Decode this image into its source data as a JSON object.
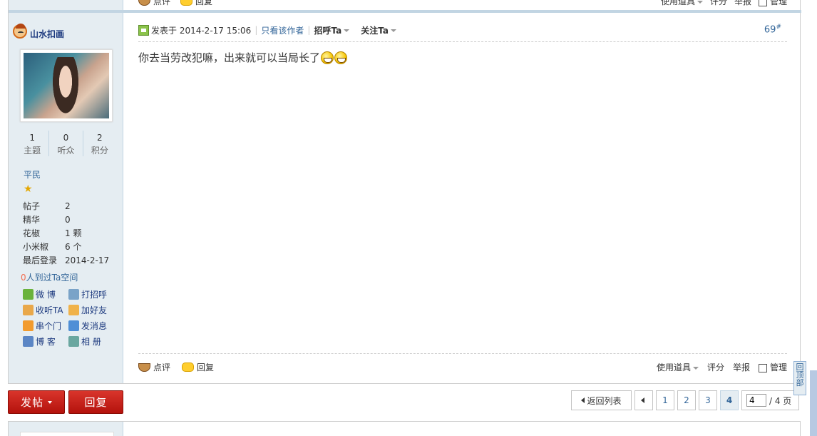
{
  "prev_post_actions": {
    "comment": "点评",
    "reply": "回复",
    "tools": "使用道具",
    "rate": "评分",
    "report": "举报",
    "manage": "管理"
  },
  "user": {
    "name": "山水扣画",
    "stats": [
      {
        "value": "1",
        "label": "主题"
      },
      {
        "value": "0",
        "label": "听众"
      },
      {
        "value": "2",
        "label": "积分"
      }
    ],
    "rank": "平民",
    "info": [
      {
        "key": "帖子",
        "value": "2"
      },
      {
        "key": "精华",
        "value": "0"
      },
      {
        "key": "花椒",
        "value": "1 颗"
      },
      {
        "key": "小米椒",
        "value": "6 个"
      },
      {
        "key": "最后登录",
        "value": "2014-2-17"
      }
    ],
    "visits_count": "0",
    "visits_text": "人到过Ta空间",
    "actions": [
      {
        "label": "微 博",
        "icon": "weibo-icon",
        "color": "#6ab23c"
      },
      {
        "label": "打招呼",
        "icon": "wave-icon",
        "color": "#7aa3c8"
      },
      {
        "label": "收听TA",
        "icon": "follow-users-icon",
        "color": "#e9a84a"
      },
      {
        "label": "加好友",
        "icon": "handshake-icon",
        "color": "#f0b24a"
      },
      {
        "label": "串个门",
        "icon": "home-icon",
        "color": "#f29b2e"
      },
      {
        "label": "发消息",
        "icon": "mail-icon",
        "color": "#4f8fd6"
      },
      {
        "label": "博 客",
        "icon": "blog-icon",
        "color": "#5b86c5"
      },
      {
        "label": "相 册",
        "icon": "album-icon",
        "color": "#6aa7a0"
      }
    ]
  },
  "post": {
    "posted_prefix": "发表于 2014-2-17 15:06",
    "only_author": "只看该作者",
    "greet": "招呼Ta",
    "follow": "关注Ta",
    "floor": "69",
    "floor_mark": "#",
    "content": "你去当劳改犯嘛，出来就可以当局长了",
    "emoticon": "grin-icon"
  },
  "post_actions": {
    "comment": "点评",
    "reply": "回复",
    "tools": "使用道具",
    "rate": "评分",
    "report": "举报",
    "manage": "管理"
  },
  "bottom": {
    "new_post": "发帖",
    "reply": "回复",
    "back_to_list": "返回列表",
    "pages": [
      "1",
      "2",
      "3",
      "4"
    ],
    "current_page": "4",
    "page_input_value": "4",
    "total_pages": "/ 4 页"
  },
  "back_to_top": "回顶部"
}
